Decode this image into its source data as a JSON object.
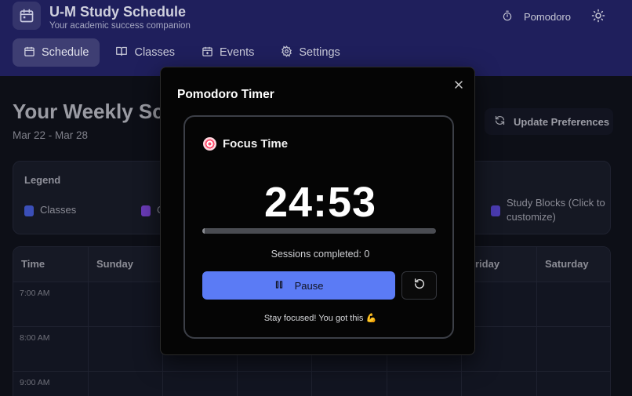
{
  "app": {
    "title": "U-M Study Schedule",
    "subtitle": "Your academic success companion",
    "pomodoro_label": "Pomodoro",
    "icons": {
      "logo": "calendar-icon",
      "timer": "stopwatch-icon",
      "theme": "sun-icon"
    }
  },
  "nav": {
    "items": [
      {
        "label": "Schedule",
        "icon": "calendar-icon",
        "active": true
      },
      {
        "label": "Classes",
        "icon": "book-open-icon",
        "active": false
      },
      {
        "label": "Events",
        "icon": "calendar-plus-icon",
        "active": false
      },
      {
        "label": "Settings",
        "icon": "gear-icon",
        "active": false
      }
    ]
  },
  "page": {
    "title": "Your Weekly Sc",
    "date_range": "Mar 22 - Mar 28",
    "update_button": "Update Preferences"
  },
  "legend": {
    "title": "Legend",
    "items": [
      {
        "label": "Classes",
        "color": "#3b4fb8"
      },
      {
        "label": "C",
        "color": "#6a3bb8"
      },
      {
        "label": "Study Blocks (Click to customize)",
        "color": "#4a3bb0"
      }
    ]
  },
  "schedule": {
    "time_header": "Time",
    "days": [
      "Sunday",
      "riday",
      "Saturday"
    ],
    "times": [
      "7:00 AM",
      "8:00 AM",
      "9:00 AM"
    ]
  },
  "modal": {
    "title": "Pomodoro Timer",
    "mode_label": "Focus Time",
    "time": "24:53",
    "progress_fraction": 0.0047,
    "sessions": "Sessions completed: 0",
    "pause_label": "Pause",
    "encouragement": "Stay focused! You got this 💪",
    "colors": {
      "accent": "#5b7bf5"
    }
  }
}
